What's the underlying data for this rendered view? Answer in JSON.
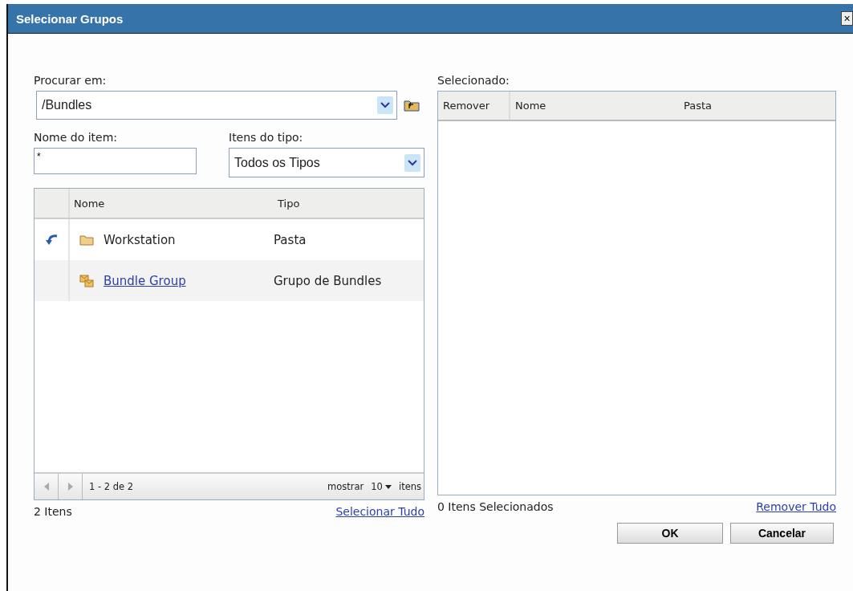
{
  "window": {
    "title": "Selecionar Grupos",
    "close": "×"
  },
  "browse": {
    "label": "Procurar em:",
    "value": "/Bundles"
  },
  "name_filter": {
    "label": "Nome do item:",
    "value": "*"
  },
  "type_filter": {
    "label": "Itens do tipo:",
    "value": "Todos os Tipos"
  },
  "table": {
    "columns": [
      "Nome",
      "Tipo"
    ],
    "rows": [
      {
        "kind": "folder",
        "name": "Workstation",
        "type": "Pasta",
        "up_link": true
      },
      {
        "kind": "bundle-group",
        "name": "Bundle Group",
        "type": "Grupo de Bundles",
        "up_link": false
      }
    ],
    "pager": {
      "range": "1 - 2 de 2",
      "show": "mostrar",
      "count": "10",
      "items": "itens"
    }
  },
  "left_footer": {
    "count": "2 Itens",
    "link": "Selecionar Tudo"
  },
  "selected": {
    "label": "Selecionado:",
    "columns": [
      "Remover",
      "Nome",
      "Pasta"
    ],
    "count": "0 Itens Selecionados",
    "link": "Remover Tudo"
  },
  "buttons": [
    "OK",
    "Cancelar"
  ]
}
